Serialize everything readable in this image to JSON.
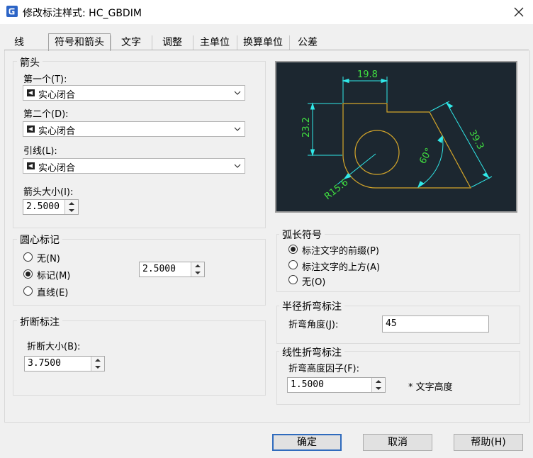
{
  "window": {
    "title": "修改标注样式: HC_GBDIM",
    "icon": "gcad-app-icon"
  },
  "tabs": [
    "线",
    "符号和箭头",
    "文字",
    "调整",
    "主单位",
    "换算单位",
    "公差"
  ],
  "active_tab": "符号和箭头",
  "arrows": {
    "title": "箭头",
    "first_label": "第一个(T):",
    "first_value": "实心闭合",
    "second_label": "第二个(D):",
    "second_value": "实心闭合",
    "leader_label": "引线(L):",
    "leader_value": "实心闭合",
    "size_label": "箭头大小(I):",
    "size_value": "2.5000"
  },
  "center_marks": {
    "title": "圆心标记",
    "options": [
      "无(N)",
      "标记(M)",
      "直线(E)"
    ],
    "selected": "标记(M)",
    "size_value": "2.5000"
  },
  "break": {
    "title": "折断标注",
    "size_label": "折断大小(B):",
    "size_value": "3.7500"
  },
  "preview": {
    "dims": {
      "width": "19.8",
      "height": "23.2",
      "slant": "39.3",
      "angle": "60°",
      "radius": "R15.6"
    },
    "colors": {
      "background": "#1c2730",
      "geometry": "#d4a62a",
      "dimension": "#30e8e8",
      "text": "#40e040"
    }
  },
  "arc_length": {
    "title": "弧长符号",
    "options": [
      "标注文字的前缀(P)",
      "标注文字的上方(A)",
      "无(O)"
    ],
    "selected": "标注文字的前缀(P)"
  },
  "radius_jog": {
    "title": "半径折弯标注",
    "angle_label": "折弯角度(J):",
    "angle_value": "45"
  },
  "linear_jog": {
    "title": "线性折弯标注",
    "factor_label": "折弯高度因子(F):",
    "factor_value": "1.5000",
    "suffix": "* 文字高度"
  },
  "buttons": {
    "ok": "确定",
    "cancel": "取消",
    "help": "帮助(H)"
  }
}
